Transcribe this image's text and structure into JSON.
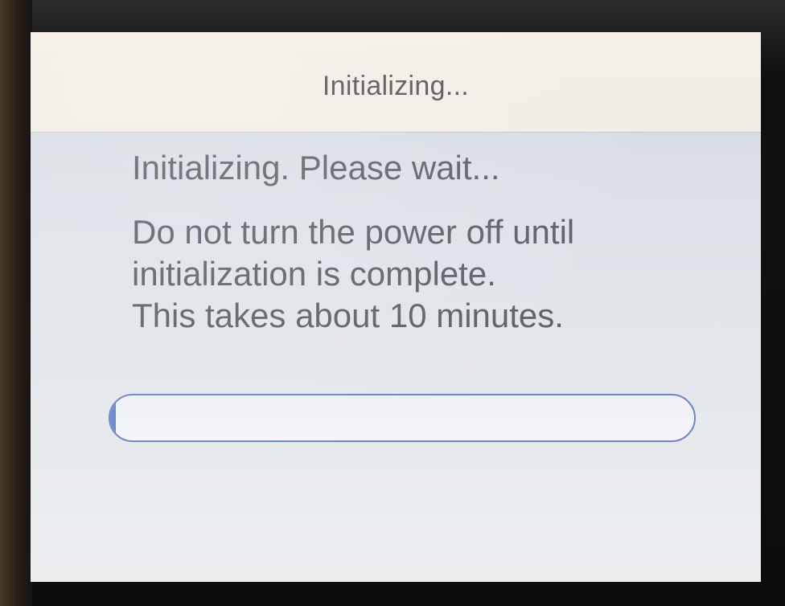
{
  "dialog": {
    "title": "Initializing...",
    "message_line1": "Initializing. Please wait...",
    "message_line2": "Do not turn the power off until",
    "message_line3": "initialization is complete.",
    "message_line4": "This takes about 10 minutes."
  },
  "progress": {
    "value_percent": 1
  },
  "colors": {
    "progress_outline": "#6e86c8",
    "title_bar_bg": "#f1ede6",
    "text": "#5e6166"
  }
}
